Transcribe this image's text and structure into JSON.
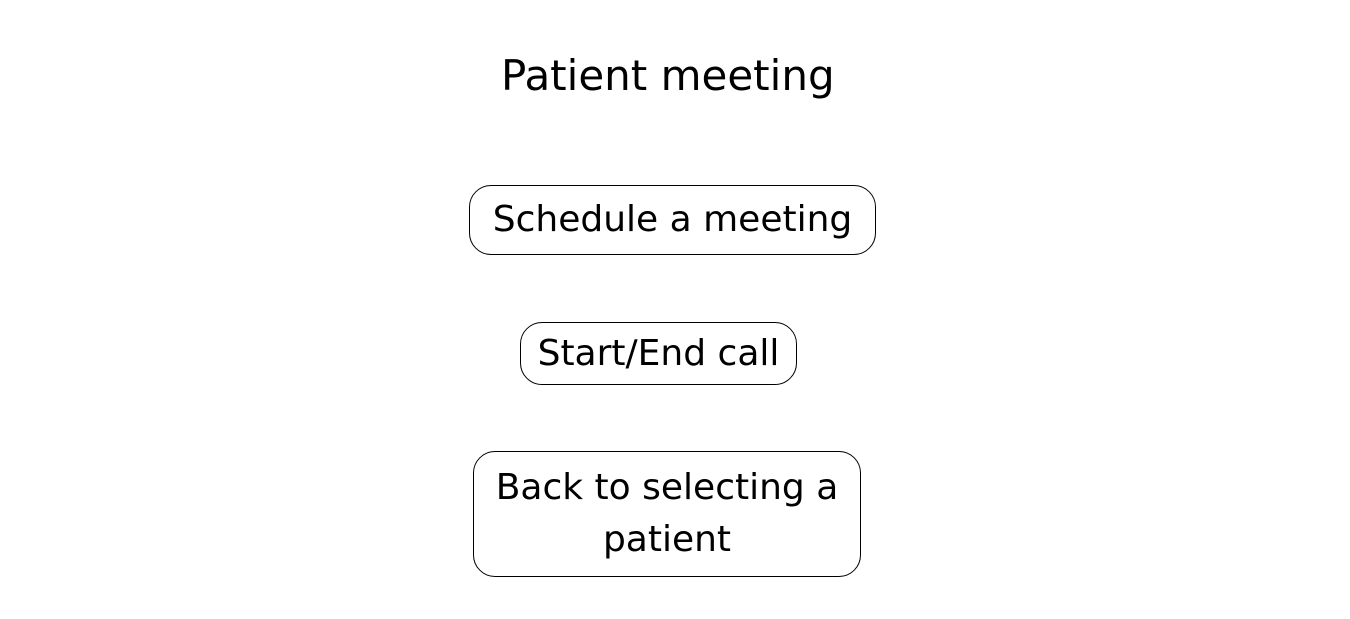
{
  "page": {
    "title": "Patient meeting"
  },
  "actions": {
    "schedule_label": "Schedule a meeting",
    "call_label": "Start/End call",
    "back_label": "Back to selecting a patient"
  },
  "colors": {
    "background": "#ffffff",
    "text": "#000000",
    "border": "#000000"
  }
}
